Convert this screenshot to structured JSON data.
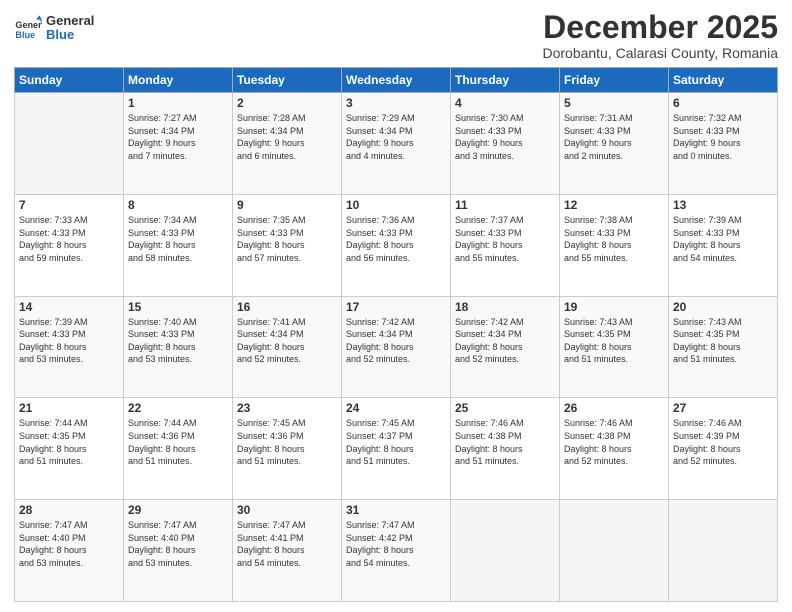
{
  "header": {
    "logo_line1": "General",
    "logo_line2": "Blue",
    "month_title": "December 2025",
    "subtitle": "Dorobantu, Calarasi County, Romania"
  },
  "weekdays": [
    "Sunday",
    "Monday",
    "Tuesday",
    "Wednesday",
    "Thursday",
    "Friday",
    "Saturday"
  ],
  "weeks": [
    [
      {
        "day": "",
        "info": ""
      },
      {
        "day": "1",
        "info": "Sunrise: 7:27 AM\nSunset: 4:34 PM\nDaylight: 9 hours\nand 7 minutes."
      },
      {
        "day": "2",
        "info": "Sunrise: 7:28 AM\nSunset: 4:34 PM\nDaylight: 9 hours\nand 6 minutes."
      },
      {
        "day": "3",
        "info": "Sunrise: 7:29 AM\nSunset: 4:34 PM\nDaylight: 9 hours\nand 4 minutes."
      },
      {
        "day": "4",
        "info": "Sunrise: 7:30 AM\nSunset: 4:33 PM\nDaylight: 9 hours\nand 3 minutes."
      },
      {
        "day": "5",
        "info": "Sunrise: 7:31 AM\nSunset: 4:33 PM\nDaylight: 9 hours\nand 2 minutes."
      },
      {
        "day": "6",
        "info": "Sunrise: 7:32 AM\nSunset: 4:33 PM\nDaylight: 9 hours\nand 0 minutes."
      }
    ],
    [
      {
        "day": "7",
        "info": "Sunrise: 7:33 AM\nSunset: 4:33 PM\nDaylight: 8 hours\nand 59 minutes."
      },
      {
        "day": "8",
        "info": "Sunrise: 7:34 AM\nSunset: 4:33 PM\nDaylight: 8 hours\nand 58 minutes."
      },
      {
        "day": "9",
        "info": "Sunrise: 7:35 AM\nSunset: 4:33 PM\nDaylight: 8 hours\nand 57 minutes."
      },
      {
        "day": "10",
        "info": "Sunrise: 7:36 AM\nSunset: 4:33 PM\nDaylight: 8 hours\nand 56 minutes."
      },
      {
        "day": "11",
        "info": "Sunrise: 7:37 AM\nSunset: 4:33 PM\nDaylight: 8 hours\nand 55 minutes."
      },
      {
        "day": "12",
        "info": "Sunrise: 7:38 AM\nSunset: 4:33 PM\nDaylight: 8 hours\nand 55 minutes."
      },
      {
        "day": "13",
        "info": "Sunrise: 7:39 AM\nSunset: 4:33 PM\nDaylight: 8 hours\nand 54 minutes."
      }
    ],
    [
      {
        "day": "14",
        "info": "Sunrise: 7:39 AM\nSunset: 4:33 PM\nDaylight: 8 hours\nand 53 minutes."
      },
      {
        "day": "15",
        "info": "Sunrise: 7:40 AM\nSunset: 4:33 PM\nDaylight: 8 hours\nand 53 minutes."
      },
      {
        "day": "16",
        "info": "Sunrise: 7:41 AM\nSunset: 4:34 PM\nDaylight: 8 hours\nand 52 minutes."
      },
      {
        "day": "17",
        "info": "Sunrise: 7:42 AM\nSunset: 4:34 PM\nDaylight: 8 hours\nand 52 minutes."
      },
      {
        "day": "18",
        "info": "Sunrise: 7:42 AM\nSunset: 4:34 PM\nDaylight: 8 hours\nand 52 minutes."
      },
      {
        "day": "19",
        "info": "Sunrise: 7:43 AM\nSunset: 4:35 PM\nDaylight: 8 hours\nand 51 minutes."
      },
      {
        "day": "20",
        "info": "Sunrise: 7:43 AM\nSunset: 4:35 PM\nDaylight: 8 hours\nand 51 minutes."
      }
    ],
    [
      {
        "day": "21",
        "info": "Sunrise: 7:44 AM\nSunset: 4:35 PM\nDaylight: 8 hours\nand 51 minutes."
      },
      {
        "day": "22",
        "info": "Sunrise: 7:44 AM\nSunset: 4:36 PM\nDaylight: 8 hours\nand 51 minutes."
      },
      {
        "day": "23",
        "info": "Sunrise: 7:45 AM\nSunset: 4:36 PM\nDaylight: 8 hours\nand 51 minutes."
      },
      {
        "day": "24",
        "info": "Sunrise: 7:45 AM\nSunset: 4:37 PM\nDaylight: 8 hours\nand 51 minutes."
      },
      {
        "day": "25",
        "info": "Sunrise: 7:46 AM\nSunset: 4:38 PM\nDaylight: 8 hours\nand 51 minutes."
      },
      {
        "day": "26",
        "info": "Sunrise: 7:46 AM\nSunset: 4:38 PM\nDaylight: 8 hours\nand 52 minutes."
      },
      {
        "day": "27",
        "info": "Sunrise: 7:46 AM\nSunset: 4:39 PM\nDaylight: 8 hours\nand 52 minutes."
      }
    ],
    [
      {
        "day": "28",
        "info": "Sunrise: 7:47 AM\nSunset: 4:40 PM\nDaylight: 8 hours\nand 53 minutes."
      },
      {
        "day": "29",
        "info": "Sunrise: 7:47 AM\nSunset: 4:40 PM\nDaylight: 8 hours\nand 53 minutes."
      },
      {
        "day": "30",
        "info": "Sunrise: 7:47 AM\nSunset: 4:41 PM\nDaylight: 8 hours\nand 54 minutes."
      },
      {
        "day": "31",
        "info": "Sunrise: 7:47 AM\nSunset: 4:42 PM\nDaylight: 8 hours\nand 54 minutes."
      },
      {
        "day": "",
        "info": ""
      },
      {
        "day": "",
        "info": ""
      },
      {
        "day": "",
        "info": ""
      }
    ]
  ]
}
